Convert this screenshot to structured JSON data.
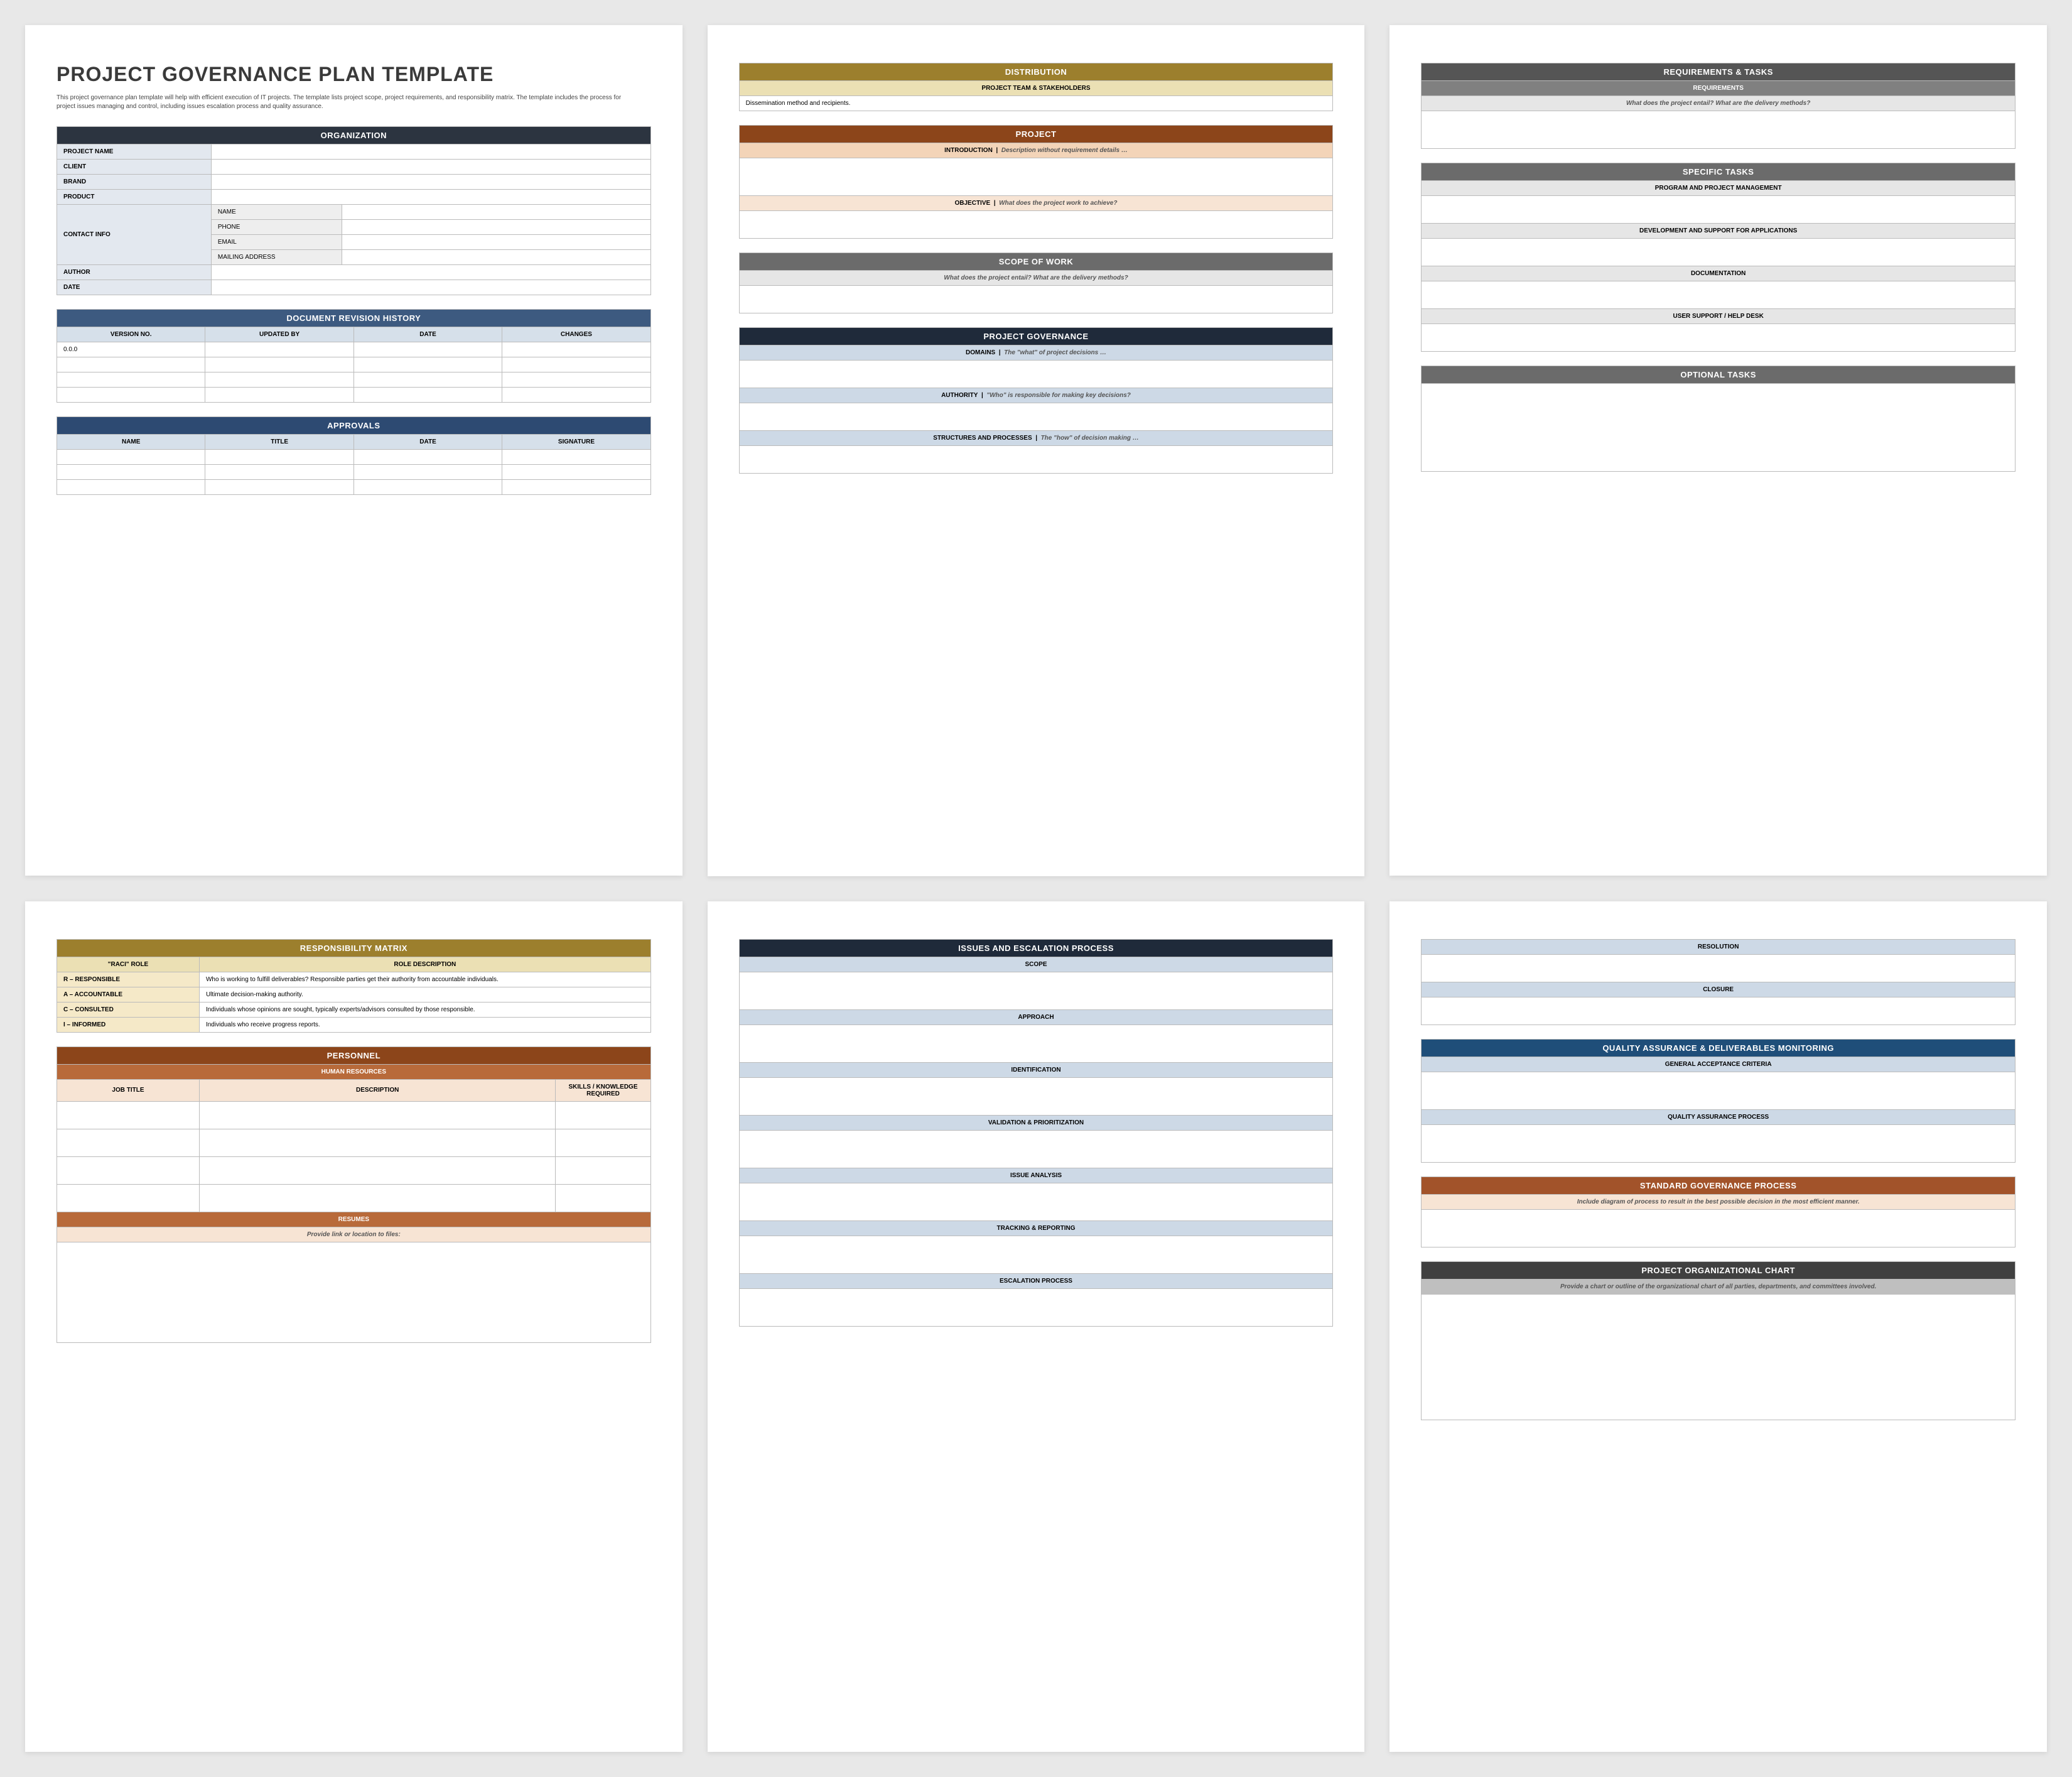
{
  "title": "PROJECT GOVERNANCE PLAN TEMPLATE",
  "intro": "This project governance plan template will help with efficient execution of IT projects. The template lists project scope, project requirements, and responsibility matrix. The template includes the process for project issues managing and control, including issues escalation process and quality assurance.",
  "page1": {
    "org_hdr": "ORGANIZATION",
    "fields": {
      "project_name": "PROJECT NAME",
      "client": "CLIENT",
      "brand": "BRAND",
      "product": "PRODUCT",
      "contact": "CONTACT INFO",
      "contact_name": "NAME",
      "contact_phone": "PHONE",
      "contact_email": "EMAIL",
      "contact_mail": "MAILING ADDRESS",
      "author": "AUTHOR",
      "date": "DATE"
    },
    "rev_hdr": "DOCUMENT REVISION HISTORY",
    "rev_cols": {
      "v": "VERSION NO.",
      "u": "UPDATED BY",
      "d": "DATE",
      "c": "CHANGES"
    },
    "rev_row0": "0.0.0",
    "appr_hdr": "APPROVALS",
    "appr_cols": {
      "n": "NAME",
      "t": "TITLE",
      "d": "DATE",
      "s": "SIGNATURE"
    }
  },
  "page2": {
    "dist_hdr": "DISTRIBUTION",
    "team_sub": "PROJECT TEAM & STAKEHOLDERS",
    "team_hint": "Dissemination method and recipients.",
    "proj_hdr": "PROJECT",
    "intro_lbl": "INTRODUCTION",
    "intro_hint": "Description without requirement details …",
    "obj_lbl": "OBJECTIVE",
    "obj_hint": "What does the project work to achieve?",
    "scope_hdr": "SCOPE OF WORK",
    "scope_hint": "What does the project entail? What are the delivery methods?",
    "gov_hdr": "PROJECT GOVERNANCE",
    "domains_lbl": "DOMAINS",
    "domains_hint": "The \"what\" of project decisions …",
    "auth_lbl": "AUTHORITY",
    "auth_hint": "\"Who\" is responsible for making key decisions?",
    "struct_lbl": "STRUCTURES AND PROCESSES",
    "struct_hint": "The \"how\" of decision making …"
  },
  "page3": {
    "req_hdr": "REQUIREMENTS & TASKS",
    "req_sub": "REQUIREMENTS",
    "req_hint": "What does the project entail? What are the delivery methods?",
    "tasks_hdr": "SPECIFIC TASKS",
    "t1": "PROGRAM AND PROJECT MANAGEMENT",
    "t2": "DEVELOPMENT AND SUPPORT FOR APPLICATIONS",
    "t3": "DOCUMENTATION",
    "t4": "USER SUPPORT / HELP DESK",
    "opt_hdr": "OPTIONAL TASKS"
  },
  "page4": {
    "resp_hdr": "RESPONSIBILITY MATRIX",
    "col_role": "\"RACI\" ROLE",
    "col_desc": "ROLE DESCRIPTION",
    "rows": [
      {
        "role": "R – RESPONSIBLE",
        "desc": "Who is working to fulfill deliverables? Responsible parties get their authority from accountable individuals."
      },
      {
        "role": "A – ACCOUNTABLE",
        "desc": "Ultimate decision-making authority."
      },
      {
        "role": "C – CONSULTED",
        "desc": "Individuals whose opinions are sought, typically experts/advisors consulted by those responsible."
      },
      {
        "role": "I – INFORMED",
        "desc": "Individuals who receive progress reports."
      }
    ],
    "pers_hdr": "PERSONNEL",
    "hr_sub": "HUMAN RESOURCES",
    "hr_cols": {
      "jt": "JOB TITLE",
      "d": "DESCRIPTION",
      "sk": "SKILLS / KNOWLEDGE REQUIRED"
    },
    "res_sub": "RESUMES",
    "res_hint": "Provide link or location to files:"
  },
  "page5": {
    "iss_hdr": "ISSUES AND ESCALATION PROCESS",
    "s1": "SCOPE",
    "s2": "APPROACH",
    "s3": "IDENTIFICATION",
    "s4": "VALIDATION & PRIORITIZATION",
    "s5": "ISSUE ANALYSIS",
    "s6": "TRACKING & REPORTING",
    "s7": "ESCALATION PROCESS"
  },
  "page6": {
    "r1": "RESOLUTION",
    "r2": "CLOSURE",
    "qa_hdr": "QUALITY ASSURANCE & DELIVERABLES MONITORING",
    "qa1": "GENERAL ACCEPTANCE CRITERIA",
    "qa2": "QUALITY ASSURANCE PROCESS",
    "std_hdr": "STANDARD GOVERNANCE PROCESS",
    "std_hint": "Include diagram of process to result in the best possible decision in the most efficient manner.",
    "org_hdr": "PROJECT ORGANIZATIONAL CHART",
    "org_hint": "Provide a chart or outline of the organizational chart of all parties, departments, and committees involved."
  }
}
